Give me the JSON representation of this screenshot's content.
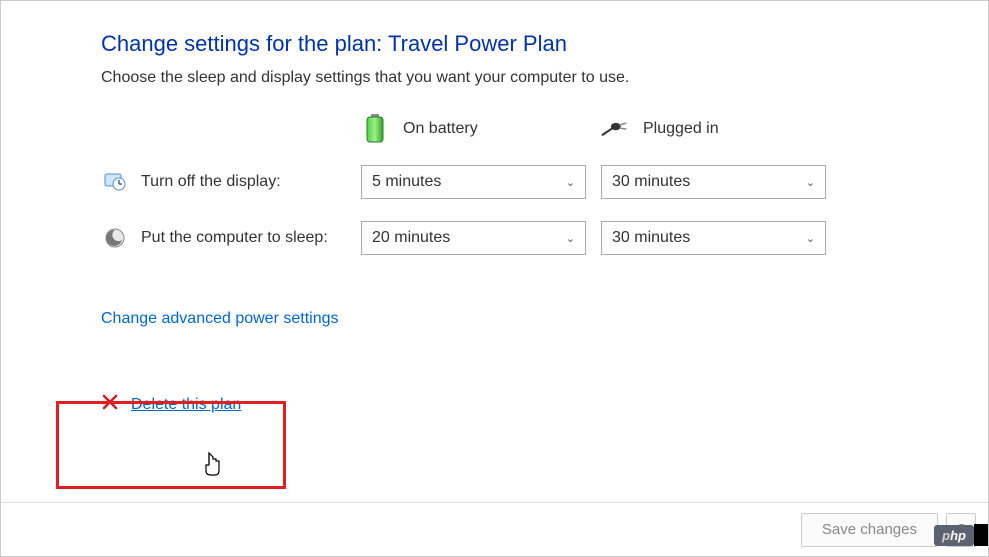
{
  "title": "Change settings for the plan: Travel Power Plan",
  "subtitle": "Choose the sleep and display settings that you want your computer to use.",
  "columns": {
    "battery": "On battery",
    "plugged": "Plugged in"
  },
  "rows": {
    "display": {
      "label": "Turn off the display:",
      "battery": "5 minutes",
      "plugged": "30 minutes"
    },
    "sleep": {
      "label": "Put the computer to sleep:",
      "battery": "20 minutes",
      "plugged": "30 minutes"
    }
  },
  "links": {
    "advanced": "Change advanced power settings",
    "delete": "Delete this plan"
  },
  "buttons": {
    "save": "Save changes",
    "cancel": "C"
  },
  "watermark": "php"
}
